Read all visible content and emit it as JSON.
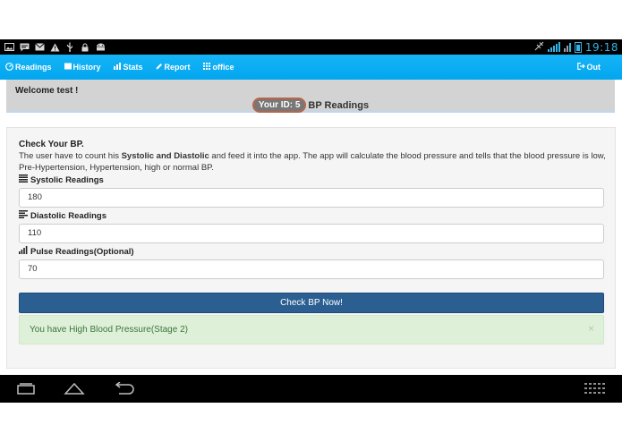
{
  "status_bar": {
    "left_icons": [
      "image-icon",
      "chat-icon",
      "mail-icon",
      "warning-icon",
      "usb-icon",
      "lock-icon",
      "android-icon"
    ],
    "time": "19:18",
    "accent_color": "#34b5e5"
  },
  "nav": {
    "items": [
      {
        "label": "Readings",
        "icon": "gauge-icon"
      },
      {
        "label": "History",
        "icon": "film-icon"
      },
      {
        "label": "Stats",
        "icon": "stats-icon"
      },
      {
        "label": "Report",
        "icon": "pencil-icon"
      },
      {
        "label": "office",
        "icon": "grid-icon"
      }
    ],
    "logout_label": "Out",
    "background_color": "#03a9f4"
  },
  "welcome": {
    "text": "Welcome test !",
    "id_badge": "Your ID: 5",
    "heading": "BP Readings"
  },
  "form": {
    "title": "Check Your BP.",
    "desc_1": "The user have to count his ",
    "desc_bold": "Systolic and Diastolic",
    "desc_2": " and feed it into the app. The app will calculate the blood pressure and tells that the blood pressure is low, Pre-Hypertension, Hypertension, high or normal BP.",
    "systolic_label": "Systolic Readings",
    "systolic_value": "180",
    "diastolic_label": "Diastolic Readings",
    "diastolic_value": "110",
    "pulse_label": "Pulse Readings(Optional)",
    "pulse_value": "70",
    "submit_label": "Check BP Now!",
    "result_text": "You have High Blood Pressure(Stage 2)",
    "close_symbol": "×"
  }
}
